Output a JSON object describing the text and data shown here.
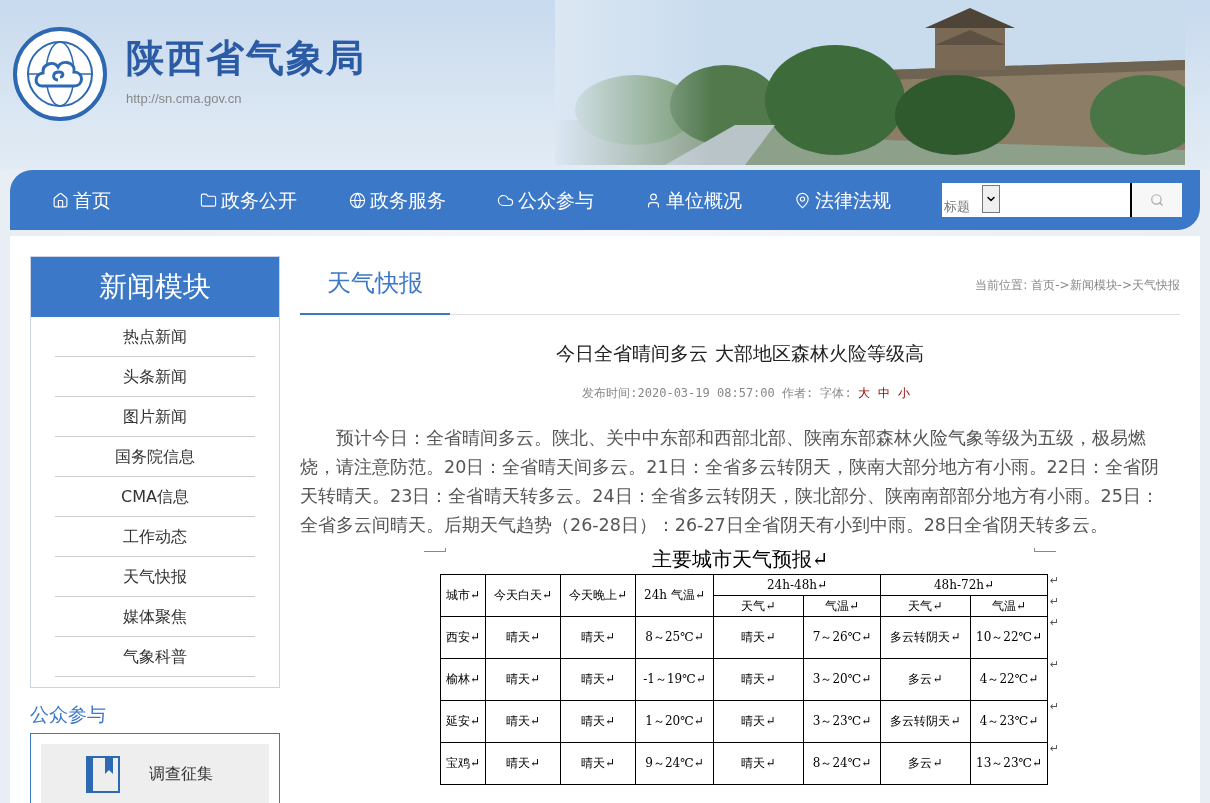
{
  "site": {
    "title": "陕西省气象局",
    "url": "http://sn.cma.gov.cn"
  },
  "nav": [
    "首页",
    "政务公开",
    "政务服务",
    "公众参与",
    "单位概况",
    "法律法规"
  ],
  "search": {
    "select_value": "标题"
  },
  "sidebar": {
    "title": "新闻模块",
    "items": [
      "热点新闻",
      "头条新闻",
      "图片新闻",
      "国务院信息",
      "CMA信息",
      "工作动态",
      "天气快报",
      "媒体聚焦",
      "气象科普"
    ]
  },
  "public": {
    "title": "公众参与",
    "button": "调查征集"
  },
  "section_title": "天气快报",
  "breadcrumb": "当前位置: 首页->新闻模块->天气快报",
  "article": {
    "title": "今日全省晴间多云 大部地区森林火险等级高",
    "meta": "发布时间:2020-03-19 08:57:00 作者: 字体:",
    "font_sizes": [
      "大",
      "中",
      "小"
    ],
    "body": "预计今日：全省晴间多云。陕北、关中中东部和西部北部、陕南东部森林火险气象等级为五级，极易燃烧，请注意防范。20日：全省晴天间多云。21日：全省多云转阴天，陕南大部分地方有小雨。22日：全省阴天转晴天。23日：全省晴天转多云。24日：全省多云转阴天，陕北部分、陕南南部部分地方有小雨。25日：全省多云间晴天。后期天气趋势（26-28日）：26-27日全省阴天有小到中雨。28日全省阴天转多云。"
  },
  "table": {
    "title": "主要城市天气预报↵",
    "header_rows": [
      [
        {
          "text": "城市↵",
          "rowspan": 2
        },
        {
          "text": "今天白天↵",
          "rowspan": 2
        },
        {
          "text": "今天晚上↵",
          "rowspan": 2
        },
        {
          "text": "24h 气温↵",
          "rowspan": 2
        },
        {
          "text": "24h-48h↵",
          "colspan": 2
        },
        {
          "text": "48h-72h↵",
          "colspan": 2
        }
      ],
      [
        {
          "text": "天气↵"
        },
        {
          "text": "气温↵"
        },
        {
          "text": "天气↵"
        },
        {
          "text": "气温↵"
        }
      ]
    ],
    "header_end_marks": [
      "↵",
      "↵"
    ],
    "rows": [
      {
        "cells": [
          "西安↵",
          "晴天↵",
          "晴天↵",
          "8～25℃↵",
          "晴天↵",
          "7～26℃↵",
          "多云转阴天↵",
          "10～22℃↵"
        ],
        "end_mark": "↵"
      },
      {
        "cells": [
          "榆林↵",
          "晴天↵",
          "晴天↵",
          "-1～19℃↵",
          "晴天↵",
          "3～20℃↵",
          "多云↵",
          "4～22℃↵"
        ],
        "end_mark": "↵"
      },
      {
        "cells": [
          "延安↵",
          "晴天↵",
          "晴天↵",
          "1～20℃↵",
          "晴天↵",
          "3～23℃↵",
          "多云转阴天↵",
          "4～23℃↵"
        ],
        "end_mark": "↵"
      },
      {
        "cells": [
          "宝鸡↵",
          "晴天↵",
          "晴天↵",
          "9～24℃↵",
          "晴天↵",
          "8～24℃↵",
          "多云↵",
          "13～23℃↵"
        ],
        "end_mark": "↵"
      }
    ]
  }
}
